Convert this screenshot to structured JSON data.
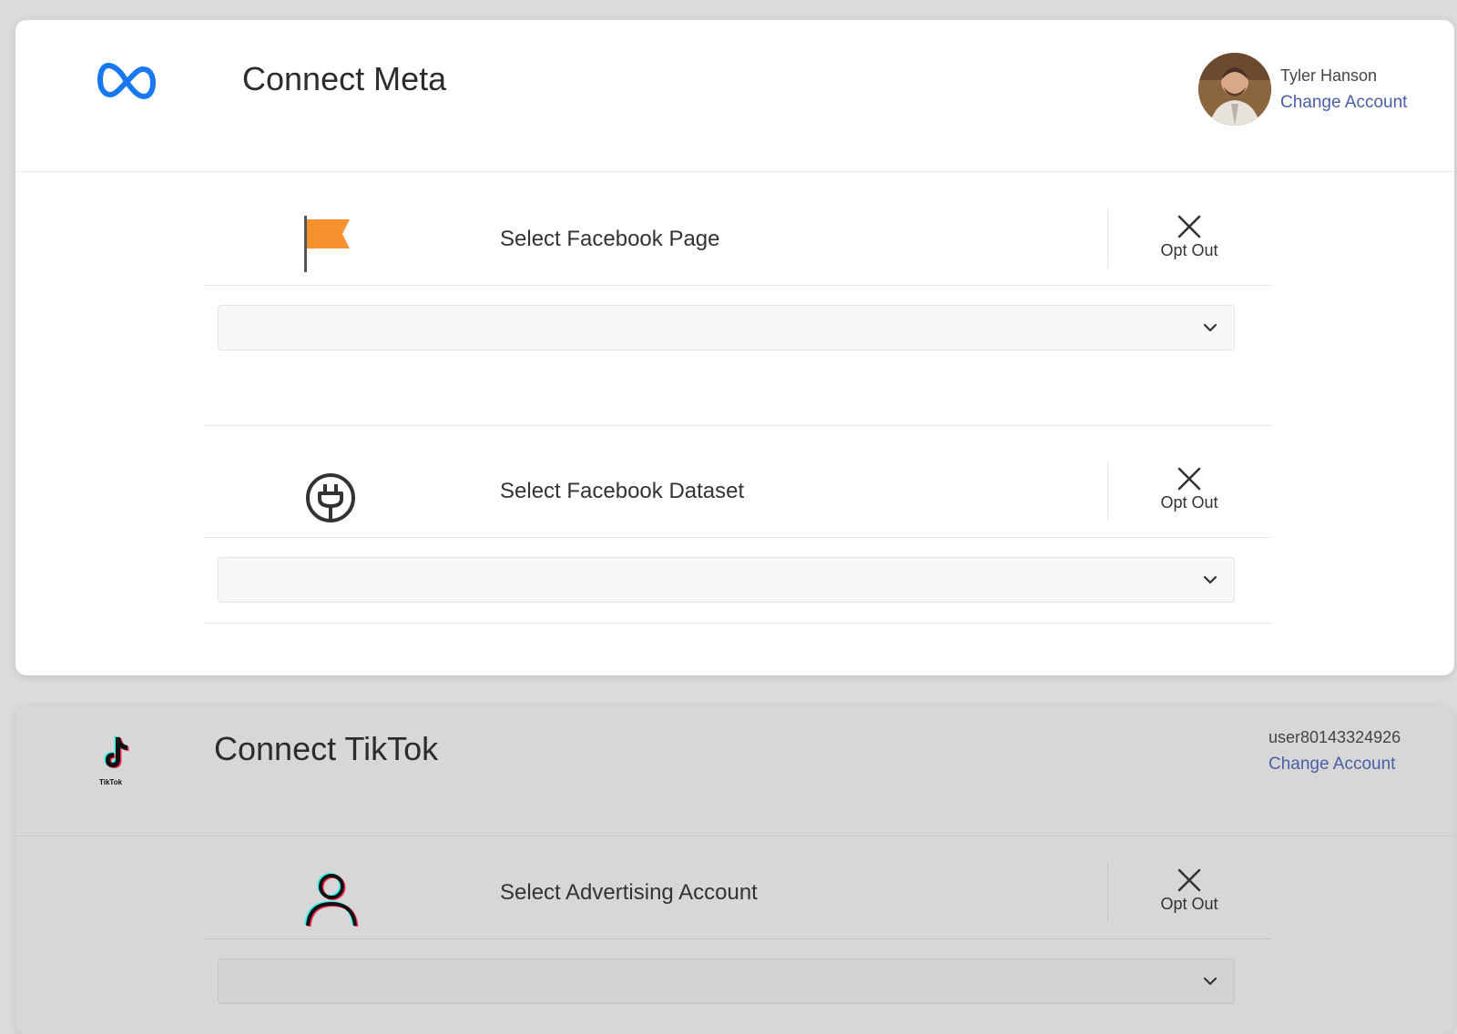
{
  "meta": {
    "title": "Connect Meta",
    "account_name": "Tyler Hanson",
    "change_account": "Change Account",
    "brand_color": "#1877F2",
    "sections": [
      {
        "label": "Select Facebook Page",
        "icon": "flag-icon",
        "opt_out": "Opt Out",
        "select_value": ""
      },
      {
        "label": "Select Facebook Dataset",
        "icon": "plug-icon",
        "opt_out": "Opt Out",
        "select_value": ""
      }
    ]
  },
  "tiktok": {
    "title": "Connect TikTok",
    "logo_text": "TikTok",
    "account_name": "user80143324926",
    "change_account": "Change Account",
    "sections": [
      {
        "label": "Select Advertising Account",
        "icon": "user-icon",
        "opt_out": "Opt Out",
        "select_value": ""
      }
    ]
  },
  "colors": {
    "link": "#4a5fa8",
    "flag": "#F7922F"
  }
}
